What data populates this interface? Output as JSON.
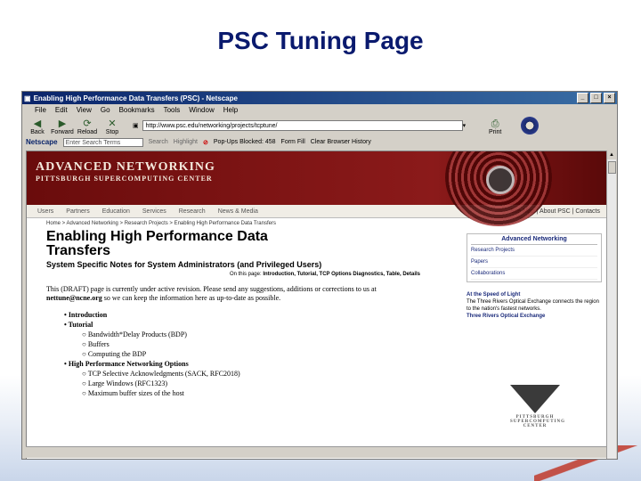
{
  "slide": {
    "title": "PSC Tuning Page"
  },
  "browser": {
    "window_title": "Enabling High Performance Data Transfers (PSC) - Netscape",
    "window_buttons": [
      "_",
      "□",
      "×"
    ],
    "menu": [
      "File",
      "Edit",
      "View",
      "Go",
      "Bookmarks",
      "Tools",
      "Window",
      "Help"
    ],
    "nav": [
      {
        "label": "Back",
        "icon": "◀"
      },
      {
        "label": "Forward",
        "icon": "▶"
      },
      {
        "label": "Reload",
        "icon": "⟳"
      },
      {
        "label": "Stop",
        "icon": "✕"
      }
    ],
    "bookmark_icon": "▣",
    "address": "http://www.psc.edu/networking/projects/tcptune/",
    "print_label": "Print",
    "print_icon": "⎙",
    "search_bar": {
      "netscape_label": "Netscape",
      "search_placeholder": "Enter Search Terms",
      "search_button": "Search",
      "highlight": "Highlight",
      "popups": "Pop-Ups Blocked: 458",
      "form_fill": "Form Fill",
      "clear_history": "Clear Browser History"
    }
  },
  "webpage": {
    "banner_title": "ADVANCED NETWORKING",
    "banner_subtitle": "PITTSBURGH SUPERCOMPUTING CENTER",
    "site_nav": [
      "Users",
      "Partners",
      "Education",
      "Services",
      "Research",
      "News & Media"
    ],
    "site_nav_right": "Site Map | About PSC | Contacts",
    "breadcrumb": "Home > Advanced Networking > Research Projects > Enabling High Performance Data Transfers",
    "heading": "Enabling High Performance Data Transfers",
    "subheading": "System Specific Notes for System Administrators (and Privileged Users)",
    "on_this_page_label": "On this page:",
    "on_this_page_links": "Introduction, Tutorial, TCP Options Diagnostics, Table, Details",
    "draft_notice_start": "This (DRAFT) page is currently under active revision. Please send any suggestions, additions or corrections to us at ",
    "draft_email": "nettune@ncne.org",
    "draft_notice_end": " so we can keep the information here as up-to-date as possible.",
    "toc": [
      {
        "level": 1,
        "text": "Introduction"
      },
      {
        "level": 1,
        "text": "Tutorial"
      },
      {
        "level": 2,
        "text": "Bandwidth*Delay Products (BDP)"
      },
      {
        "level": 2,
        "text": "Buffers"
      },
      {
        "level": 2,
        "text": "Computing the BDP"
      },
      {
        "level": 1,
        "text": "High Performance Networking Options"
      },
      {
        "level": 2,
        "text": "TCP Selective Acknowledgments (SACK, RFC2018)"
      },
      {
        "level": 2,
        "text": "Large Windows (RFC1323)"
      },
      {
        "level": 2,
        "text": "Maximum buffer sizes of the host"
      }
    ],
    "sidebar": {
      "head": "Advanced Networking",
      "links": [
        "Research Projects",
        "Papers",
        "Collaborations"
      ],
      "speed_head": "At the Speed of Light",
      "speed_text": "The Three Rivers Optical Exchange connects the region to the nation's fastest networks.",
      "speed_link": "Three Rivers Optical Exchange"
    },
    "logo_text": "PITTSBURGH SUPERCOMPUTING CENTER"
  }
}
